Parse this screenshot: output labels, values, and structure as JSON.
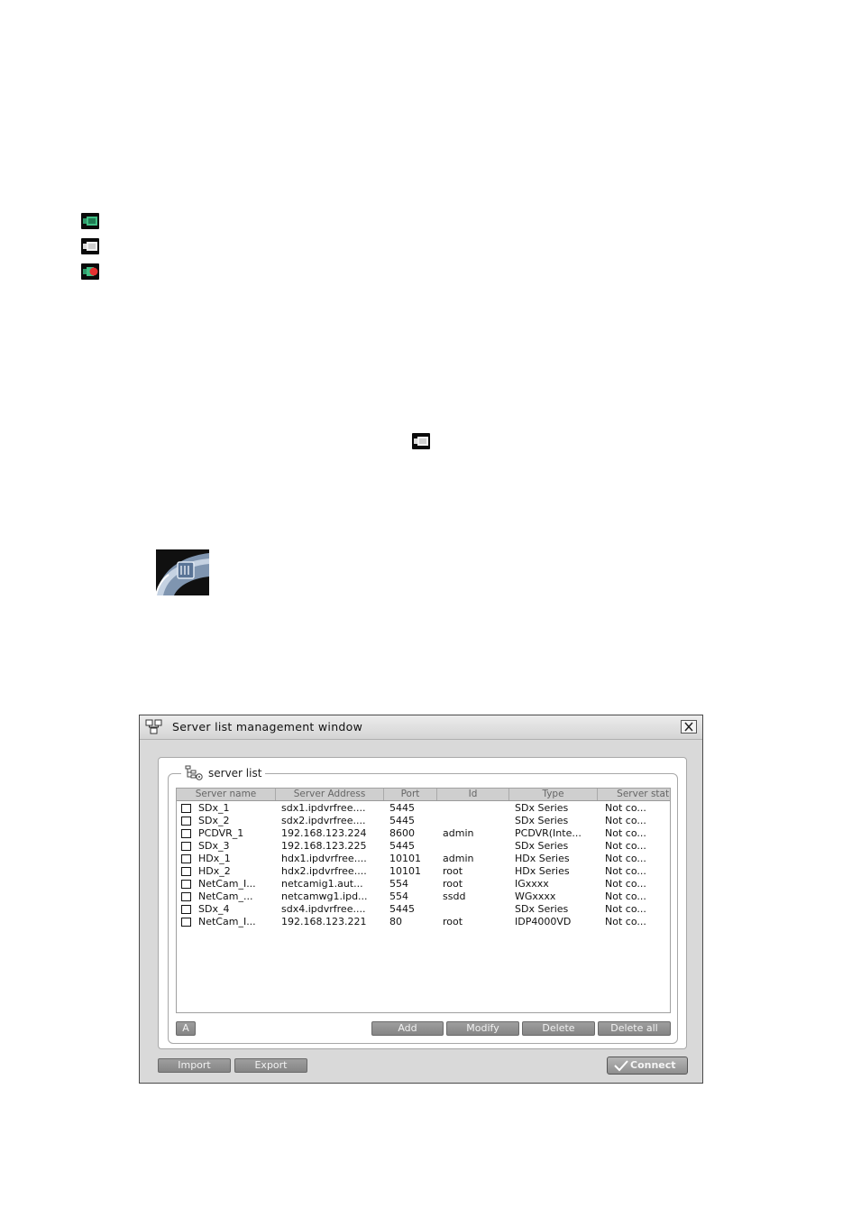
{
  "window": {
    "title": "Server list management window",
    "group_label": "server list",
    "columns": [
      "Server name",
      "Server Address",
      "Port",
      "Id",
      "Type",
      "Server stati"
    ],
    "rows": [
      [
        "SDx_1",
        "sdx1.ipdvrfree....",
        "5445",
        "",
        "SDx Series",
        "Not co..."
      ],
      [
        "SDx_2",
        "sdx2.ipdvrfree....",
        "5445",
        "",
        "SDx Series",
        "Not co..."
      ],
      [
        "PCDVR_1",
        "192.168.123.224",
        "8600",
        "admin",
        "PCDVR(Inte...",
        "Not co..."
      ],
      [
        "SDx_3",
        "192.168.123.225",
        "5445",
        "",
        "SDx Series",
        "Not co..."
      ],
      [
        "HDx_1",
        "hdx1.ipdvrfree....",
        "10101",
        "admin",
        "HDx Series",
        "Not co..."
      ],
      [
        "HDx_2",
        "hdx2.ipdvrfree....",
        "10101",
        "root",
        "HDx Series",
        "Not co..."
      ],
      [
        "NetCam_I...",
        "netcamig1.aut...",
        "554",
        "root",
        "IGxxxx",
        "Not co..."
      ],
      [
        "NetCam_...",
        "netcamwg1.ipd...",
        "554",
        "ssdd",
        "WGxxxx",
        "Not co..."
      ],
      [
        "SDx_4",
        "sdx4.ipdvrfree....",
        "5445",
        "",
        "SDx Series",
        "Not co..."
      ],
      [
        "NetCam_I...",
        "192.168.123.221",
        "80",
        "root",
        "IDP4000VD",
        "Not co..."
      ]
    ],
    "buttons": {
      "select_all": "A",
      "add": "Add",
      "modify": "Modify",
      "delete": "Delete",
      "delete_all": "Delete all",
      "import": "Import",
      "export": "Export",
      "connect": "Connect"
    }
  },
  "icons": {
    "status_connected": "camera-green-icon",
    "status_disconnected": "camera-white-icon",
    "status_recording": "camera-red-icon",
    "disc_photo": "dvr-disc-photo"
  }
}
